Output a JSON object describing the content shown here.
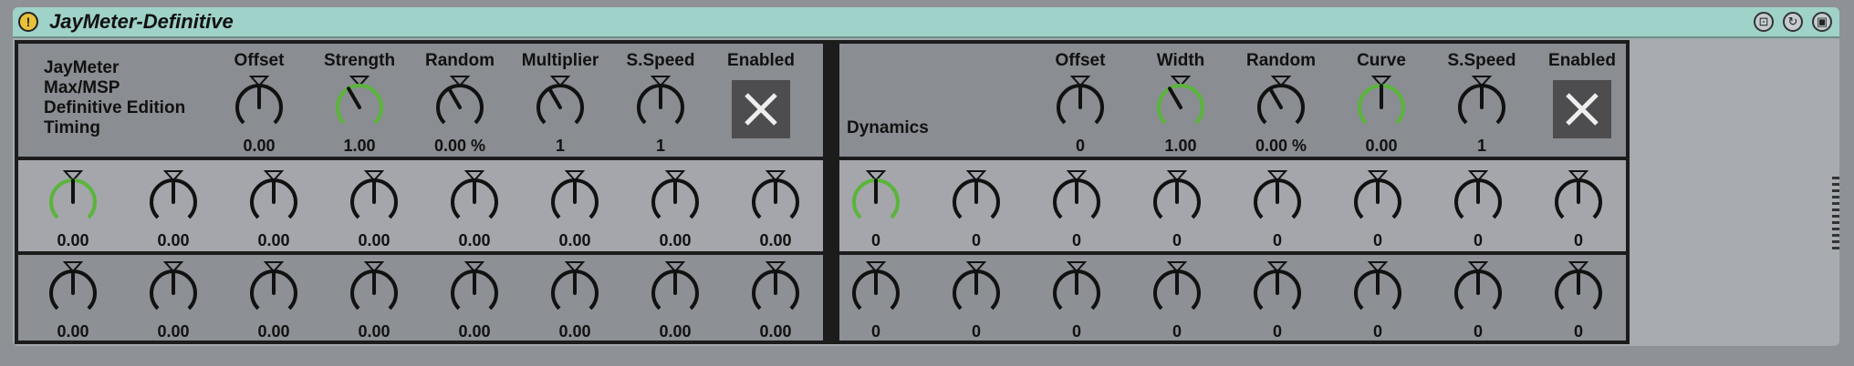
{
  "device": {
    "title": "JayMeter-Definitive",
    "power_glyph": "!",
    "buttons": [
      "lock-icon",
      "hot-swap-icon",
      "save-icon"
    ]
  },
  "info": [
    "JayMeter",
    "Max/MSP",
    "Definitive Edition",
    "Timing"
  ],
  "timing": {
    "headers": [
      "Offset",
      "Strength",
      "Random",
      "Multiplier",
      "S.Speed",
      "Enabled"
    ],
    "values": [
      "0.00",
      "1.00",
      "0.00 %",
      "1",
      "1"
    ]
  },
  "dynamics": {
    "label": "Dynamics",
    "headers": [
      "Offset",
      "Width",
      "Random",
      "Curve",
      "S.Speed",
      "Enabled"
    ],
    "values": [
      "0",
      "1.00",
      "0.00 %",
      "0.00",
      "1"
    ]
  },
  "rows": {
    "timing_row1": [
      "0.00",
      "0.00",
      "0.00",
      "0.00",
      "0.00",
      "0.00",
      "0.00",
      "0.00"
    ],
    "dynamics_row1": [
      "0",
      "0",
      "0",
      "0",
      "0",
      "0",
      "0",
      "0"
    ],
    "timing_row2": [
      "0.00",
      "0.00",
      "0.00",
      "0.00",
      "0.00",
      "0.00",
      "0.00",
      "0.00"
    ],
    "dynamics_row2": [
      "0",
      "0",
      "0",
      "0",
      "0",
      "0",
      "0",
      "0"
    ]
  },
  "colors": {
    "knob_active": "#5ab53a",
    "knob_default": "#111111",
    "titlebar": "#9fd2c9"
  }
}
